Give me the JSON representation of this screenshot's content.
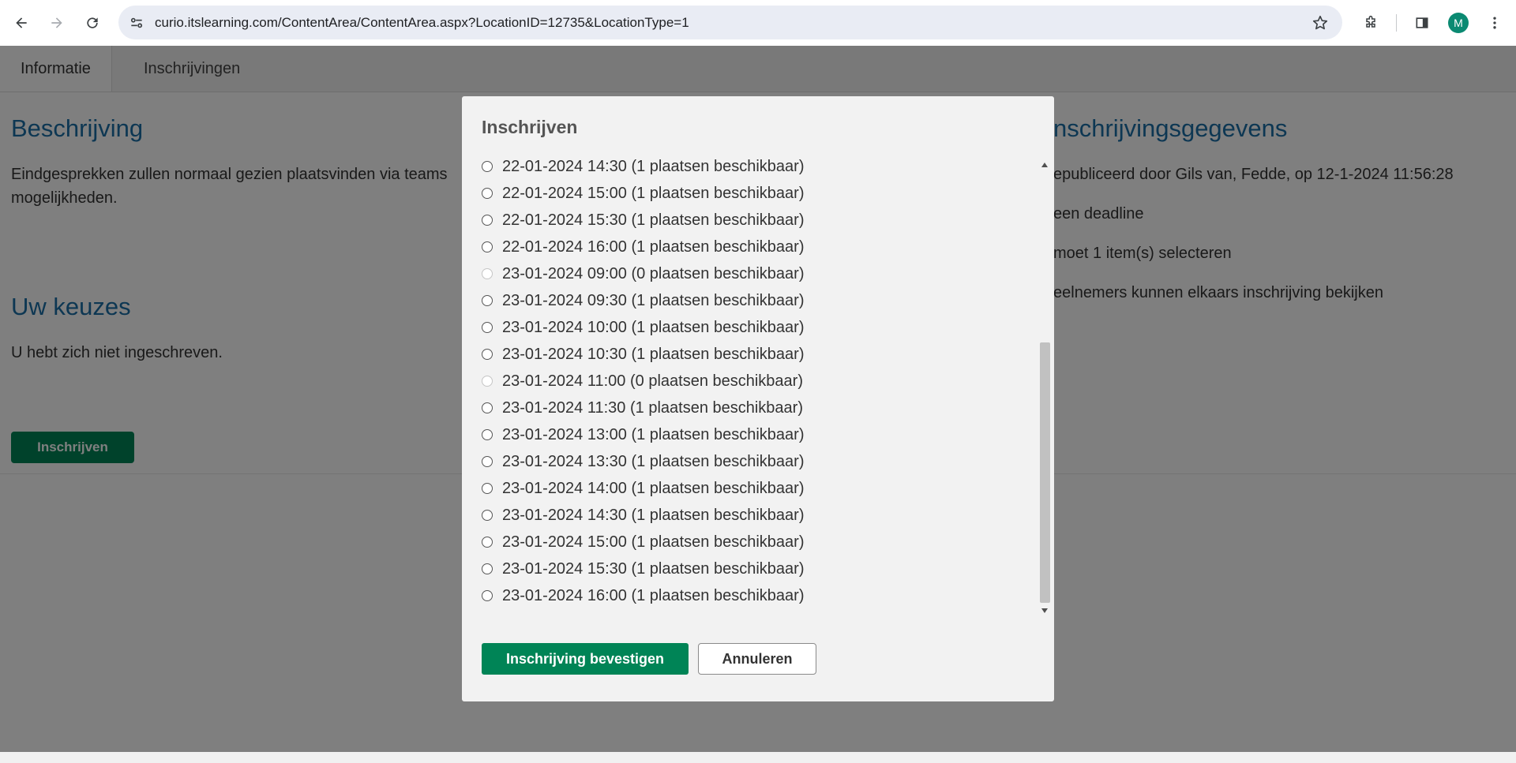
{
  "browser": {
    "url": "curio.itslearning.com/ContentArea/ContentArea.aspx?LocationID=12735&LocationType=1",
    "avatar_letter": "M",
    "accent_color": "#0b8a72"
  },
  "tabs": [
    {
      "label": "Informatie",
      "active": true
    },
    {
      "label": "Inschrijvingen",
      "active": false
    }
  ],
  "left": {
    "description_heading": "Beschrijving",
    "description_text": "Eindgesprekken zullen normaal gezien plaatsvinden via teams",
    "description_text_cont": "mogelijkheden.",
    "choices_heading": "Uw keuzes",
    "choices_text": "U hebt zich niet ingeschreven.",
    "enroll_button": "Inschrijven"
  },
  "right": {
    "heading": "nschrijvingsgegevens",
    "published": "epubliceerd door Gils van, Fedde, op 12-1-2024 11:56:28",
    "deadline": "een deadline",
    "select_rule": "moet 1 item(s) selecteren",
    "visibility": "eelnemers kunnen elkaars inschrijving bekijken"
  },
  "modal": {
    "title": "Inschrijven",
    "options": [
      {
        "label": "22-01-2024 14:30 (1 plaatsen beschikbaar)",
        "available": true
      },
      {
        "label": "22-01-2024 15:00 (1 plaatsen beschikbaar)",
        "available": true
      },
      {
        "label": "22-01-2024 15:30 (1 plaatsen beschikbaar)",
        "available": true
      },
      {
        "label": "22-01-2024 16:00 (1 plaatsen beschikbaar)",
        "available": true
      },
      {
        "label": "23-01-2024 09:00 (0 plaatsen beschikbaar)",
        "available": false
      },
      {
        "label": "23-01-2024 09:30 (1 plaatsen beschikbaar)",
        "available": true
      },
      {
        "label": "23-01-2024 10:00 (1 plaatsen beschikbaar)",
        "available": true
      },
      {
        "label": "23-01-2024 10:30 (1 plaatsen beschikbaar)",
        "available": true
      },
      {
        "label": "23-01-2024 11:00 (0 plaatsen beschikbaar)",
        "available": false
      },
      {
        "label": "23-01-2024 11:30 (1 plaatsen beschikbaar)",
        "available": true
      },
      {
        "label": "23-01-2024 13:00 (1 plaatsen beschikbaar)",
        "available": true
      },
      {
        "label": "23-01-2024 13:30 (1 plaatsen beschikbaar)",
        "available": true
      },
      {
        "label": "23-01-2024 14:00 (1 plaatsen beschikbaar)",
        "available": true
      },
      {
        "label": "23-01-2024 14:30 (1 plaatsen beschikbaar)",
        "available": true
      },
      {
        "label": "23-01-2024 15:00 (1 plaatsen beschikbaar)",
        "available": true
      },
      {
        "label": "23-01-2024 15:30 (1 plaatsen beschikbaar)",
        "available": true
      },
      {
        "label": "23-01-2024 16:00 (1 plaatsen beschikbaar)",
        "available": true
      }
    ],
    "confirm_button": "Inschrijving bevestigen",
    "cancel_button": "Annuleren"
  },
  "colors": {
    "primary_green": "#008456",
    "heading_blue": "#1a6fa6"
  }
}
